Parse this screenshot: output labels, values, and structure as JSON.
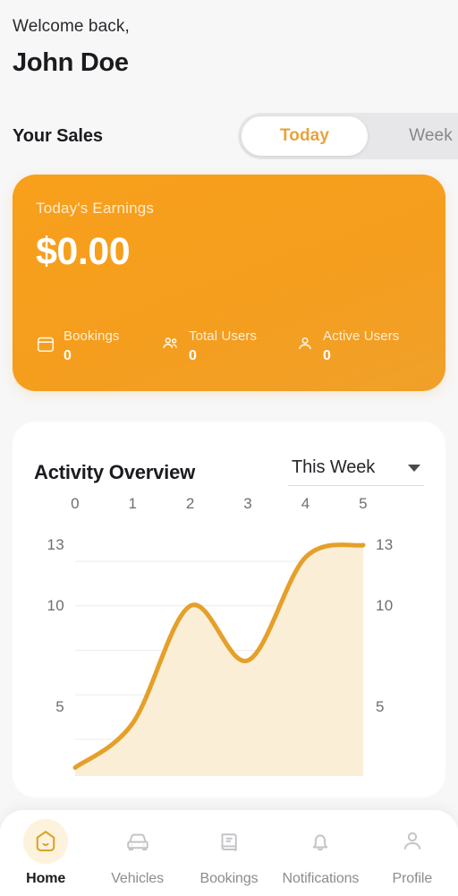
{
  "header": {
    "welcome": "Welcome back,",
    "user_name": "John Doe"
  },
  "sales": {
    "title": "Your Sales",
    "toggle": {
      "options": [
        "Today",
        "Week"
      ],
      "selected": "Today"
    }
  },
  "earnings_card": {
    "label": "Today's Earnings",
    "value": "$0.00",
    "accent_color": "#f59e1e",
    "stats": [
      {
        "icon": "calendar-icon",
        "label": "Bookings",
        "value": "0"
      },
      {
        "icon": "users-group-icon",
        "label": "Total Users",
        "value": "0"
      },
      {
        "icon": "user-icon",
        "label": "Active Users",
        "value": "0"
      }
    ]
  },
  "activity": {
    "title": "Activity Overview",
    "range": {
      "selected": "This Week",
      "caret_icon": "chevron-down-icon"
    },
    "chart_data": {
      "type": "area",
      "title": "Activity Overview",
      "xlabel": "",
      "ylabel": "",
      "x": [
        0,
        1,
        2,
        3,
        4,
        5
      ],
      "values": [
        2.0,
        4.2,
        10.0,
        7.3,
        12.4,
        13.0
      ],
      "xticks": [
        "0",
        "1",
        "2",
        "3",
        "4",
        "5"
      ],
      "yticks_left": [
        "13",
        "10",
        "5"
      ],
      "yticks_right": [
        "13",
        "10",
        "5"
      ],
      "ylim": [
        3,
        13
      ],
      "xlim": [
        0,
        5
      ],
      "grid": true,
      "gridlines": [
        12.2,
        10.0,
        7.8,
        5.6,
        3.4
      ],
      "legend": "none",
      "line_color": "#e5a02a",
      "fill_color": "#fbeed6",
      "smooth": true
    }
  },
  "bottom_nav": {
    "active": "Home",
    "items": [
      {
        "label": "Home",
        "icon": "home-icon"
      },
      {
        "label": "Vehicles",
        "icon": "car-icon"
      },
      {
        "label": "Bookings",
        "icon": "book-icon"
      },
      {
        "label": "Notifications",
        "icon": "bell-icon"
      },
      {
        "label": "Profile",
        "icon": "person-icon"
      }
    ]
  }
}
